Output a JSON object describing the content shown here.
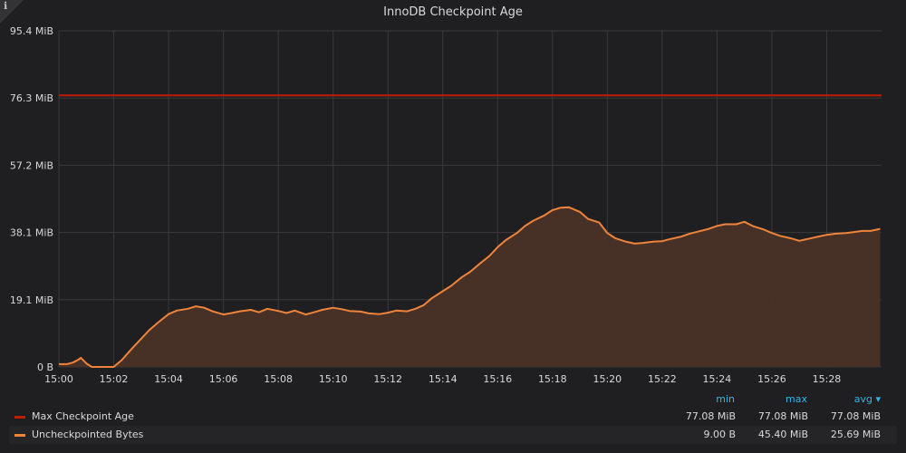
{
  "panel": {
    "title": "InnoDB Checkpoint Age",
    "info_icon": "info-icon"
  },
  "colors": {
    "background": "#1f1f21",
    "grid": "#3a3a3c",
    "max_line": "#bf1b00",
    "series_line": "#ef843c",
    "series_fill": "#4a3127",
    "legend_header": "#33b5e5"
  },
  "chart_data": {
    "type": "area",
    "title": "InnoDB Checkpoint Age",
    "ylim": [
      0,
      95.4
    ],
    "y_unit": "MiB",
    "y_ticks": [
      "0 B",
      "19.1 MiB",
      "38.1 MiB",
      "57.2 MiB",
      "76.3 MiB",
      "95.4 MiB"
    ],
    "x_ticks": [
      "15:00",
      "15:02",
      "15:04",
      "15:06",
      "15:08",
      "15:10",
      "15:12",
      "15:14",
      "15:16",
      "15:18",
      "15:20",
      "15:22",
      "15:24",
      "15:26",
      "15:28"
    ],
    "grid": true,
    "legend_position": "bottom",
    "series": [
      {
        "name": "Max Checkpoint Age",
        "type": "line",
        "color": "#bf1b00",
        "x": [
          0,
          30
        ],
        "values": [
          77.08,
          77.08
        ]
      },
      {
        "name": "Uncheckpointed Bytes",
        "type": "area",
        "color": "#ef843c",
        "x": [
          0,
          0.3,
          0.5,
          0.7,
          0.8,
          1.0,
          1.2,
          2.0,
          2.3,
          2.7,
          3.0,
          3.3,
          3.6,
          4.0,
          4.3,
          4.7,
          5.0,
          5.3,
          5.6,
          6.0,
          6.3,
          6.6,
          7.0,
          7.3,
          7.6,
          8.0,
          8.3,
          8.6,
          9.0,
          9.3,
          9.6,
          10.0,
          10.3,
          10.6,
          11.0,
          11.3,
          11.7,
          12.0,
          12.3,
          12.7,
          13.0,
          13.3,
          13.6,
          14.0,
          14.3,
          14.7,
          15.0,
          15.3,
          15.7,
          16.0,
          16.3,
          16.7,
          17.0,
          17.3,
          17.7,
          18.0,
          18.3,
          18.6,
          19.0,
          19.3,
          19.7,
          20.0,
          20.3,
          20.7,
          21.0,
          21.3,
          21.7,
          22.0,
          22.3,
          22.7,
          23.0,
          23.3,
          23.7,
          24.0,
          24.3,
          24.7,
          25.0,
          25.3,
          25.7,
          26.0,
          26.3,
          26.7,
          27.0,
          27.3,
          27.7,
          28.0,
          28.3,
          28.7,
          29.0,
          29.3,
          29.6,
          29.95
        ],
        "values": [
          0.8,
          0.8,
          1.2,
          2.0,
          2.6,
          1.0,
          0.0,
          0.0,
          2.0,
          5.5,
          8.0,
          10.5,
          12.5,
          15.0,
          16.0,
          16.5,
          17.2,
          16.8,
          15.8,
          14.9,
          15.3,
          15.8,
          16.2,
          15.5,
          16.5,
          15.9,
          15.3,
          16.0,
          14.9,
          15.5,
          16.2,
          16.8,
          16.4,
          15.9,
          15.7,
          15.2,
          15.0,
          15.4,
          16.0,
          15.8,
          16.5,
          17.5,
          19.5,
          21.5,
          23.0,
          25.5,
          27.0,
          29.0,
          31.5,
          34.0,
          36.0,
          38.0,
          40.0,
          41.5,
          43.0,
          44.5,
          45.2,
          45.3,
          44.0,
          42.0,
          41.0,
          38.0,
          36.5,
          35.5,
          35.0,
          35.2,
          35.6,
          35.7,
          36.3,
          37.0,
          37.8,
          38.4,
          39.2,
          40.0,
          40.5,
          40.5,
          41.2,
          40.0,
          39.0,
          38.0,
          37.2,
          36.5,
          35.8,
          36.3,
          37.0,
          37.5,
          37.8,
          38.0,
          38.3,
          38.6,
          38.6,
          39.2
        ]
      }
    ]
  },
  "legend": {
    "headers": {
      "min": "min",
      "max": "max",
      "avg": "avg ▾"
    },
    "rows": [
      {
        "name": "Max Checkpoint Age",
        "color": "#bf1b00",
        "min": "77.08 MiB",
        "max": "77.08 MiB",
        "avg": "77.08 MiB"
      },
      {
        "name": "Uncheckpointed Bytes",
        "color": "#ef843c",
        "min": "9.00 B",
        "max": "45.40 MiB",
        "avg": "25.69 MiB"
      }
    ]
  }
}
